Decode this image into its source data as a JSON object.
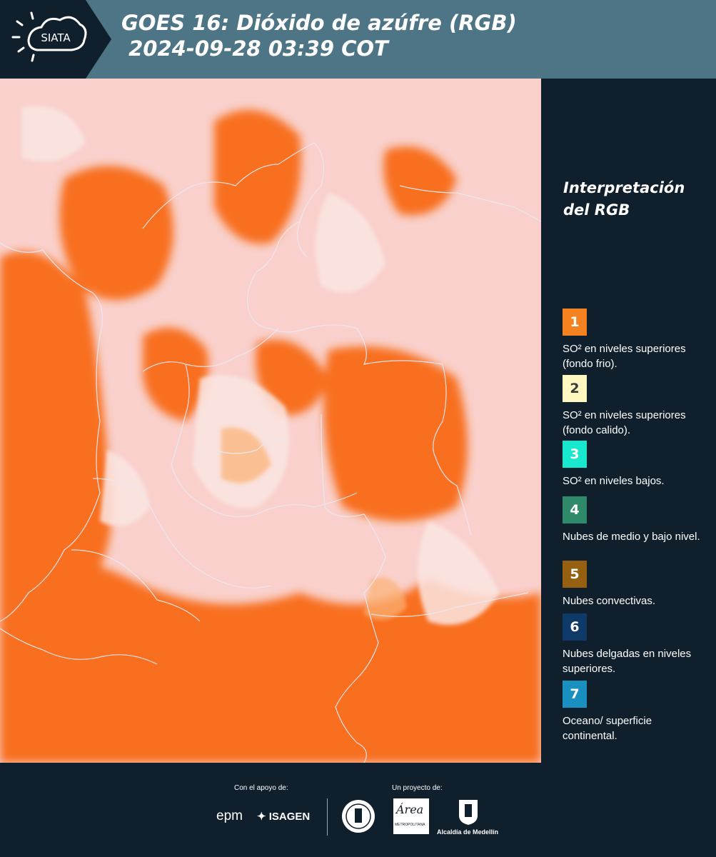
{
  "header": {
    "logo_text": "SIATA",
    "title": "GOES 16: Dióxido de azúfre (RGB)\n 2024-09-28 03:39 COT"
  },
  "legend": {
    "title": "Interpretación del RGB",
    "items": [
      {
        "number": "1",
        "color": "#f58220",
        "label": "SO² en niveles superiores (fondo frio)."
      },
      {
        "number": "2",
        "color": "#fdf7c0",
        "label": "SO² en niveles superiores (fondo calido)."
      },
      {
        "number": "3",
        "color": "#18e8cd",
        "label": "SO² en niveles bajos."
      },
      {
        "number": "4",
        "color": "#2e8a68",
        "label": "Nubes de medio y bajo nivel."
      },
      {
        "number": "5",
        "color": "#95600f",
        "label": "Nubes convectivas."
      },
      {
        "number": "6",
        "color": "#0e3968",
        "label": "Nubes delgadas en niveles superiores."
      },
      {
        "number": "7",
        "color": "#1a90c0",
        "label": "Oceano/ superficie continental."
      }
    ]
  },
  "footer": {
    "support_caption": "Con el apoyo de:",
    "project_caption": "Un proyecto de:",
    "sponsor_1": "epm",
    "sponsor_2": "ISAGEN",
    "seal_3_text": "Área",
    "seal_3_sub": "METROPOLITANA",
    "seal_4_text": "Alcaldía de Medellín"
  },
  "map": {
    "description_icon": "satellite-rgb-map",
    "colors": {
      "background": "#f7c8c2",
      "cloud_orange": "#f86a12",
      "haze": "#fbe3e0",
      "border": "#e8e4ee"
    }
  }
}
